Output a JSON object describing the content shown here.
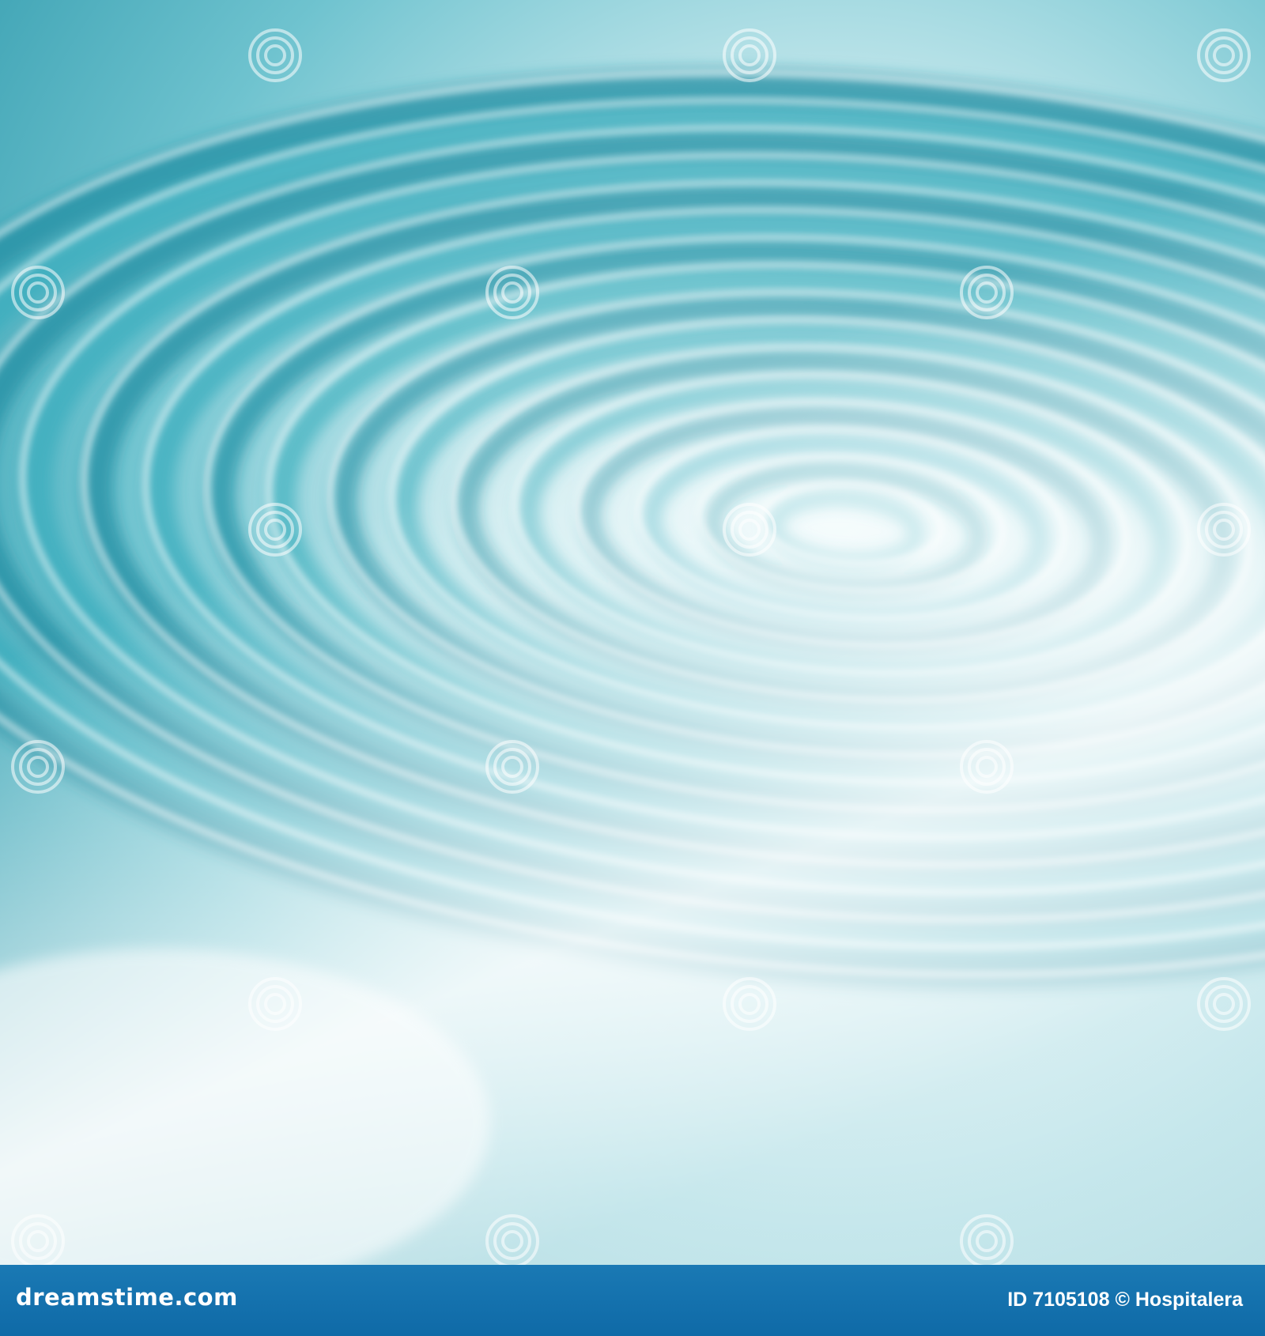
{
  "image": {
    "description_colors": {
      "deep_teal": "#1f8fa3",
      "mid_teal": "#3aaebd",
      "light_cyan": "#bfe6ec",
      "highlight": "#ffffff",
      "footer_blue": "#126fab"
    },
    "watermark": {
      "logo_icon": "spiral-logo-icon",
      "text": "dreamstime"
    }
  },
  "footer": {
    "brand": "dreamstime.com",
    "id_label": "ID 7105108",
    "copyright": "©",
    "author": "Hospitalera"
  }
}
